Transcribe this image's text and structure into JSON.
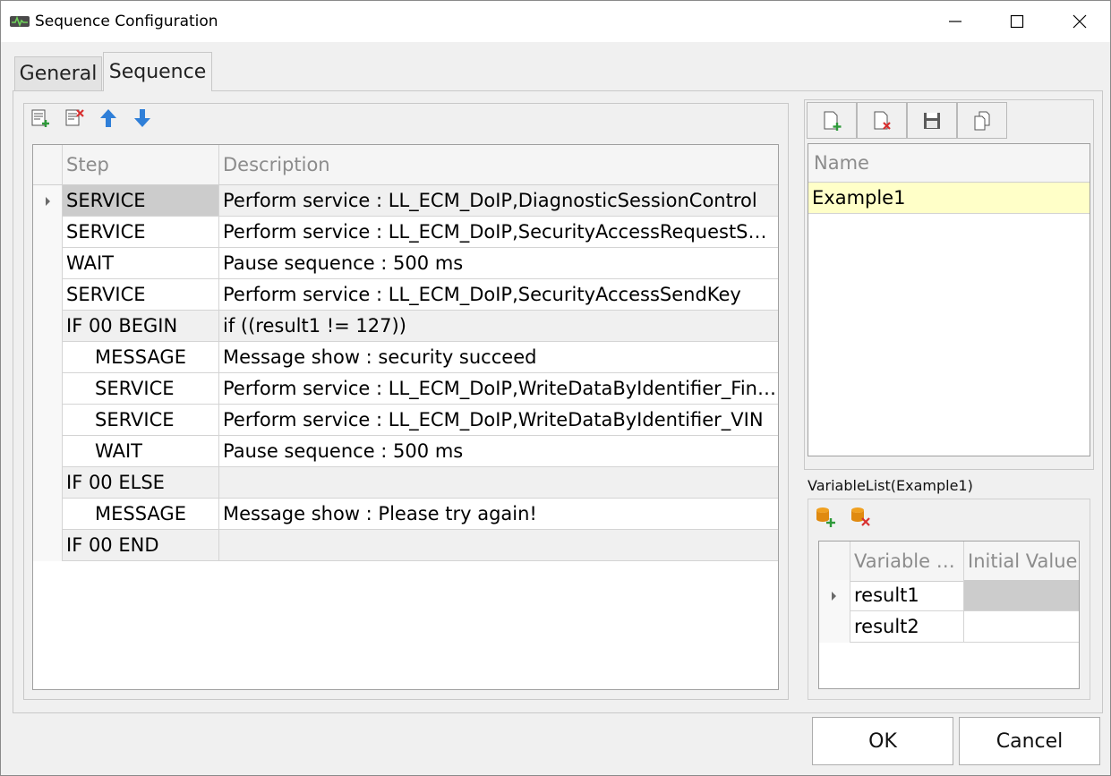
{
  "window": {
    "title": "Sequence Configuration"
  },
  "tabs": [
    {
      "label": "General",
      "active": false
    },
    {
      "label": "Sequence",
      "active": true
    }
  ],
  "sequence_toolbar": {
    "icons": [
      "add-step-icon",
      "delete-step-icon",
      "move-up-icon",
      "move-down-icon"
    ]
  },
  "sequence_table": {
    "columns": [
      "Step",
      "Description"
    ],
    "rows": [
      {
        "step": "SERVICE",
        "description": "Perform service : LL_ECM_DoIP,DiagnosticSessionControl",
        "indent": false,
        "selected": true
      },
      {
        "step": "SERVICE",
        "description": "Perform service : LL_ECM_DoIP,SecurityAccessRequestSeed",
        "indent": false
      },
      {
        "step": "WAIT",
        "description": "Pause sequence : 500 ms",
        "indent": false
      },
      {
        "step": "SERVICE",
        "description": "Perform service : LL_ECM_DoIP,SecurityAccessSendKey",
        "indent": false
      },
      {
        "step": "IF 00 BEGIN",
        "description": "if ((result1 != 127))",
        "indent": false,
        "alt": true
      },
      {
        "step": "MESSAGE",
        "description": "Message show : security succeed",
        "indent": true
      },
      {
        "step": "SERVICE",
        "description": "Perform service : LL_ECM_DoIP,WriteDataByIdentifier_Fingerprint",
        "indent": true
      },
      {
        "step": "SERVICE",
        "description": "Perform service : LL_ECM_DoIP,WriteDataByIdentifier_VIN",
        "indent": true
      },
      {
        "step": "WAIT",
        "description": "Pause sequence : 500 ms",
        "indent": true
      },
      {
        "step": "IF 00 ELSE",
        "description": "",
        "indent": false,
        "alt": true
      },
      {
        "step": "MESSAGE",
        "description": "Message show : Please try again!",
        "indent": true
      },
      {
        "step": "IF 00 END",
        "description": "",
        "indent": false,
        "alt": true
      }
    ]
  },
  "sequence_list_toolbar": {
    "icons": [
      "new-sequence-icon",
      "delete-sequence-icon",
      "save-icon",
      "copy-icon"
    ]
  },
  "sequence_list": {
    "header": "Name",
    "items": [
      "Example1"
    ]
  },
  "variable_list": {
    "label": "VariableList(Example1)",
    "toolbar_icons": [
      "add-variable-icon",
      "delete-variable-icon"
    ],
    "columns": [
      "Variable Name",
      "Initial Value"
    ],
    "rows": [
      {
        "variable": "result1",
        "initial": "",
        "selected": true
      },
      {
        "variable": "result2",
        "initial": ""
      }
    ]
  },
  "buttons": {
    "ok": "OK",
    "cancel": "Cancel"
  },
  "colors": {
    "selected_row": "#cccccc",
    "highlight_row": "#ffffc8",
    "arrow_blue": "#2f7fd8"
  }
}
